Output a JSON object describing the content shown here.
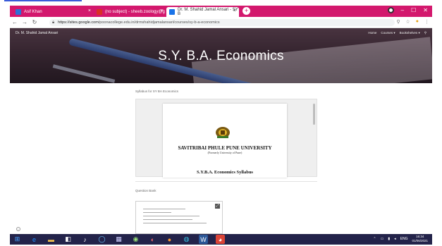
{
  "browser": {
    "tabs": [
      {
        "label": "Asif Khan",
        "favicon_color": "#2d6fd6",
        "active": false
      },
      {
        "label": "(no subject) - sheeb.zoology@g",
        "favicon_color": "#d93025",
        "active": false
      },
      {
        "label": "Dr. M. Shahid Jamal Ansari - SY B",
        "favicon_color": "#1a73e8",
        "active": true
      }
    ],
    "new_tab": "+",
    "url_host": "https://sites.google.com",
    "url_path": "/poonacollege.edu.in/drmshahidjamalansari/courses/sy-b-a-economics",
    "tab_bar_color": "#d3186d"
  },
  "site": {
    "name": "Dr. M. Shahid Jamal Ansari",
    "nav": [
      "Home",
      "Courses",
      "Bookshelves"
    ],
    "hero_title": "S.Y. B.A. Economics"
  },
  "content": {
    "section1_label": "Syllabus for SY BA Economics",
    "doc_university": "SAVITRIBAI PHULE PUNE UNIVERSITY",
    "doc_subtitle": "(Formerly University of Pune)",
    "doc_syllabus": "S.Y.B.A. Economics Syllabus",
    "section2_label": "Question Bank"
  },
  "taskbar": {
    "language": "ENG",
    "time": "16:34",
    "date": "01/06/2021",
    "color": "#23234a"
  }
}
